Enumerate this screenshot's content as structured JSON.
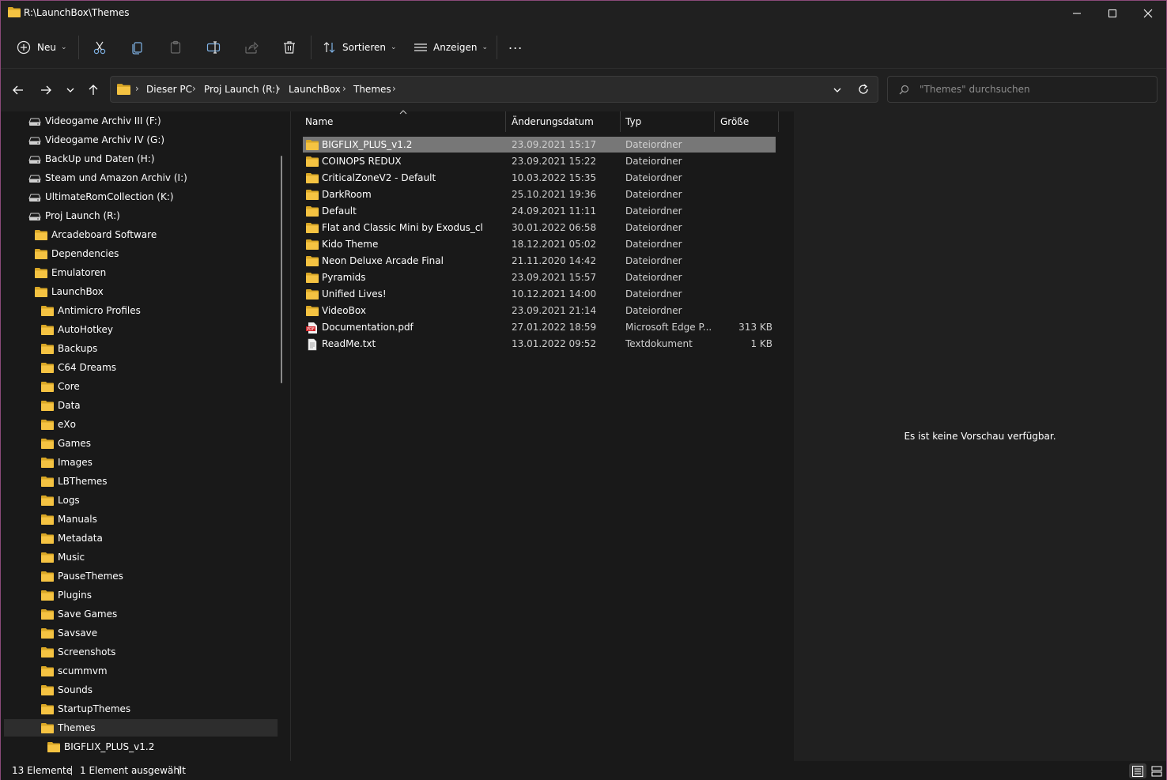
{
  "window": {
    "title": "R:\\LaunchBox\\Themes"
  },
  "colors": {
    "folder": "#f5c342",
    "folder_dark": "#d9a726",
    "selection": "#777777",
    "accent_border": "#8a4a79"
  },
  "toolbar": {
    "new_label": "Neu",
    "sort_label": "Sortieren",
    "view_label": "Anzeigen",
    "more_label": "..."
  },
  "address": {
    "crumbs": [
      "Dieser PC",
      "Proj Launch (R:)",
      "LaunchBox",
      "Themes"
    ],
    "search_placeholder": "\"Themes\" durchsuchen"
  },
  "navpane": {
    "items": [
      {
        "label": "Videogame Archiv III (F:)",
        "icon": "drive-icon",
        "level": 0
      },
      {
        "label": "Videogame Archiv IV (G:)",
        "icon": "drive-icon",
        "level": 0
      },
      {
        "label": "BackUp und Daten (H:)",
        "icon": "drive-icon",
        "level": 0
      },
      {
        "label": "Steam und Amazon Archiv (I:)",
        "icon": "drive-icon",
        "level": 0
      },
      {
        "label": "UltimateRomCollection (K:)",
        "icon": "drive-icon",
        "level": 0
      },
      {
        "label": "Proj Launch (R:)",
        "icon": "drive-icon",
        "level": 0
      },
      {
        "label": "Arcadeboard Software",
        "icon": "folder-icon",
        "level": 1
      },
      {
        "label": "Dependencies",
        "icon": "folder-icon",
        "level": 1
      },
      {
        "label": "Emulatoren",
        "icon": "folder-icon",
        "level": 1
      },
      {
        "label": "LaunchBox",
        "icon": "folder-icon",
        "level": 1
      },
      {
        "label": "Antimicro Profiles",
        "icon": "folder-icon",
        "level": 2
      },
      {
        "label": "AutoHotkey",
        "icon": "folder-icon",
        "level": 2
      },
      {
        "label": "Backups",
        "icon": "folder-icon",
        "level": 2
      },
      {
        "label": "C64 Dreams",
        "icon": "folder-icon",
        "level": 2
      },
      {
        "label": "Core",
        "icon": "folder-icon",
        "level": 2
      },
      {
        "label": "Data",
        "icon": "folder-icon",
        "level": 2
      },
      {
        "label": "eXo",
        "icon": "folder-icon",
        "level": 2
      },
      {
        "label": "Games",
        "icon": "folder-icon",
        "level": 2
      },
      {
        "label": "Images",
        "icon": "folder-icon",
        "level": 2
      },
      {
        "label": "LBThemes",
        "icon": "folder-icon",
        "level": 2
      },
      {
        "label": "Logs",
        "icon": "folder-icon",
        "level": 2
      },
      {
        "label": "Manuals",
        "icon": "folder-icon",
        "level": 2
      },
      {
        "label": "Metadata",
        "icon": "folder-icon",
        "level": 2
      },
      {
        "label": "Music",
        "icon": "folder-icon",
        "level": 2
      },
      {
        "label": "PauseThemes",
        "icon": "folder-icon",
        "level": 2
      },
      {
        "label": "Plugins",
        "icon": "folder-icon",
        "level": 2
      },
      {
        "label": "Save Games",
        "icon": "folder-icon",
        "level": 2
      },
      {
        "label": "Savsave",
        "icon": "folder-icon",
        "level": 2
      },
      {
        "label": "Screenshots",
        "icon": "folder-icon",
        "level": 2
      },
      {
        "label": "scummvm",
        "icon": "folder-icon",
        "level": 2
      },
      {
        "label": "Sounds",
        "icon": "folder-icon",
        "level": 2
      },
      {
        "label": "StartupThemes",
        "icon": "folder-icon",
        "level": 2
      },
      {
        "label": "Themes",
        "icon": "folder-icon",
        "level": 2,
        "selected": true
      },
      {
        "label": "BIGFLIX_PLUS_v1.2",
        "icon": "folder-icon",
        "level": 3
      }
    ]
  },
  "filelist": {
    "columns": {
      "name": "Name",
      "date": "Änderungsdatum",
      "type": "Typ",
      "size": "Größe"
    },
    "rows": [
      {
        "name": "BIGFLIX_PLUS_v1.2",
        "date": "23.09.2021 15:17",
        "type": "Dateiordner",
        "size": "",
        "icon": "folder-icon",
        "selected": true
      },
      {
        "name": "COINOPS REDUX",
        "date": "23.09.2021 15:22",
        "type": "Dateiordner",
        "size": "",
        "icon": "folder-icon"
      },
      {
        "name": "CriticalZoneV2 - Default",
        "date": "10.03.2022 15:35",
        "type": "Dateiordner",
        "size": "",
        "icon": "folder-icon"
      },
      {
        "name": "DarkRoom",
        "date": "25.10.2021 19:36",
        "type": "Dateiordner",
        "size": "",
        "icon": "folder-icon"
      },
      {
        "name": "Default",
        "date": "24.09.2021 11:11",
        "type": "Dateiordner",
        "size": "",
        "icon": "folder-icon"
      },
      {
        "name": "Flat and Classic Mini by Exodus_cl",
        "date": "30.01.2022 06:58",
        "type": "Dateiordner",
        "size": "",
        "icon": "folder-icon"
      },
      {
        "name": "Kido Theme",
        "date": "18.12.2021 05:02",
        "type": "Dateiordner",
        "size": "",
        "icon": "folder-icon"
      },
      {
        "name": "Neon Deluxe Arcade Final",
        "date": "21.11.2020 14:42",
        "type": "Dateiordner",
        "size": "",
        "icon": "folder-icon"
      },
      {
        "name": "Pyramids",
        "date": "23.09.2021 15:57",
        "type": "Dateiordner",
        "size": "",
        "icon": "folder-icon"
      },
      {
        "name": "Unified Lives!",
        "date": "10.12.2021 14:00",
        "type": "Dateiordner",
        "size": "",
        "icon": "folder-icon"
      },
      {
        "name": "VideoBox",
        "date": "23.09.2021 21:14",
        "type": "Dateiordner",
        "size": "",
        "icon": "folder-icon"
      },
      {
        "name": "Documentation.pdf",
        "date": "27.01.2022 18:59",
        "type": "Microsoft Edge P...",
        "size": "313 KB",
        "icon": "pdf-icon"
      },
      {
        "name": "ReadMe.txt",
        "date": "13.01.2022 09:52",
        "type": "Textdokument",
        "size": "1 KB",
        "icon": "text-file-icon"
      }
    ]
  },
  "preview": {
    "message": "Es ist keine Vorschau verfügbar."
  },
  "status": {
    "count": "13 Elemente",
    "selected": "1 Element ausgewählt"
  }
}
